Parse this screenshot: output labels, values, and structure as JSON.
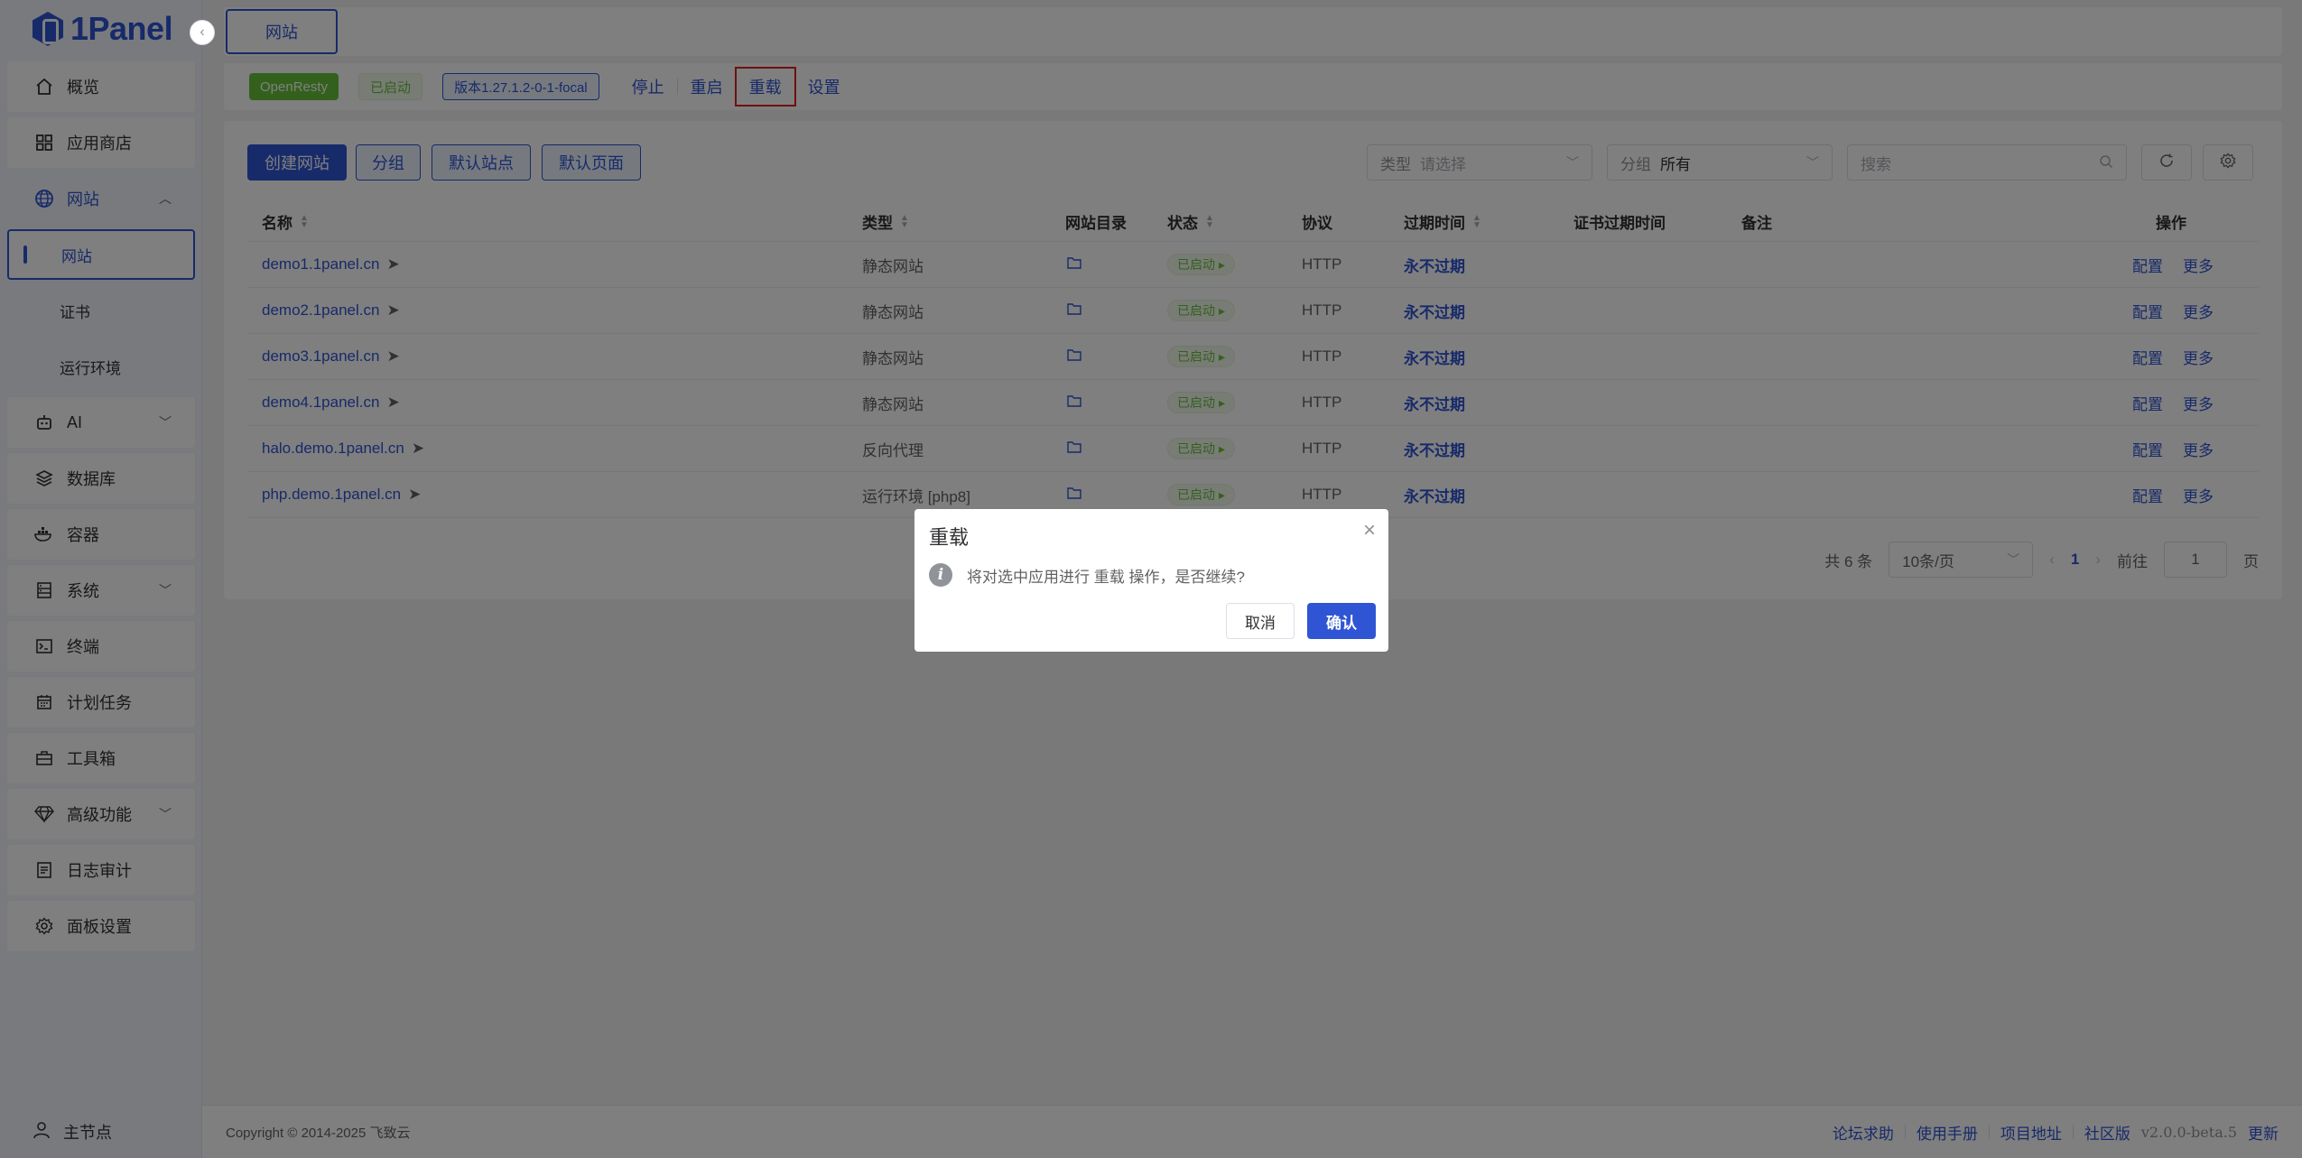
{
  "brand": {
    "name": "1Panel"
  },
  "sidebar": {
    "items": [
      {
        "label": "概览",
        "icon": "home-icon"
      },
      {
        "label": "应用商店",
        "icon": "grid-icon"
      },
      {
        "label": "网站",
        "icon": "globe-icon",
        "open": true,
        "children": [
          {
            "label": "网站",
            "active": true
          },
          {
            "label": "证书"
          },
          {
            "label": "运行环境"
          }
        ]
      },
      {
        "label": "AI",
        "icon": "robot-icon",
        "expandable": true
      },
      {
        "label": "数据库",
        "icon": "layers-icon"
      },
      {
        "label": "容器",
        "icon": "docker-icon"
      },
      {
        "label": "系统",
        "icon": "server-icon",
        "expandable": true
      },
      {
        "label": "终端",
        "icon": "terminal-icon"
      },
      {
        "label": "计划任务",
        "icon": "calendar-icon"
      },
      {
        "label": "工具箱",
        "icon": "toolbox-icon"
      },
      {
        "label": "高级功能",
        "icon": "diamond-icon",
        "expandable": true
      },
      {
        "label": "日志审计",
        "icon": "log-icon"
      },
      {
        "label": "面板设置",
        "icon": "gear-icon"
      }
    ],
    "user": "主节点"
  },
  "topbar": {
    "tab": "网站"
  },
  "appbar": {
    "app_name": "OpenResty",
    "status": "已启动",
    "version": "版本1.27.1.2-0-1-focal",
    "actions": [
      "停止",
      "重启",
      "重载",
      "设置"
    ]
  },
  "toolbar": {
    "create": "创建网站",
    "group": "分组",
    "default_site": "默认站点",
    "default_page": "默认页面",
    "type_label": "类型",
    "type_placeholder": "请选择",
    "group_label": "分组",
    "group_value": "所有",
    "search_placeholder": "搜索"
  },
  "table": {
    "headers": {
      "name": "名称",
      "type": "类型",
      "dir": "网站目录",
      "status": "状态",
      "protocol": "协议",
      "expire": "过期时间",
      "cert_expire": "证书过期时间",
      "remark": "备注",
      "ops": "操作"
    },
    "rows": [
      {
        "name": "demo1.1panel.cn",
        "type": "静态网站",
        "status": "已启动",
        "protocol": "HTTP",
        "expire": "永不过期",
        "op1": "配置",
        "op2": "更多"
      },
      {
        "name": "demo2.1panel.cn",
        "type": "静态网站",
        "status": "已启动",
        "protocol": "HTTP",
        "expire": "永不过期",
        "op1": "配置",
        "op2": "更多"
      },
      {
        "name": "demo3.1panel.cn",
        "type": "静态网站",
        "status": "已启动",
        "protocol": "HTTP",
        "expire": "永不过期",
        "op1": "配置",
        "op2": "更多"
      },
      {
        "name": "demo4.1panel.cn",
        "type": "静态网站",
        "status": "已启动",
        "protocol": "HTTP",
        "expire": "永不过期",
        "op1": "配置",
        "op2": "更多"
      },
      {
        "name": "halo.demo.1panel.cn",
        "type": "反向代理",
        "status": "已启动",
        "protocol": "HTTP",
        "expire": "永不过期",
        "op1": "配置",
        "op2": "更多"
      },
      {
        "name": "php.demo.1panel.cn",
        "type": "运行环境 [php8]",
        "status": "已启动",
        "protocol": "HTTP",
        "expire": "永不过期",
        "op1": "配置",
        "op2": "更多"
      }
    ]
  },
  "pager": {
    "total": "共 6 条",
    "page_size": "10条/页",
    "current": "1",
    "goto_label": "前往",
    "goto_value": "1",
    "page_unit": "页"
  },
  "footer": {
    "copyright": "Copyright © 2014-2025 飞致云",
    "links": [
      "论坛求助",
      "使用手册",
      "项目地址",
      "社区版"
    ],
    "version": "v2.0.0-beta.5",
    "update": "更新"
  },
  "dialog": {
    "title": "重载",
    "message": "将对选中应用进行 重载 操作，是否继续?",
    "cancel": "取消",
    "confirm": "确认"
  },
  "colors": {
    "primary": "#2f55d4",
    "success": "#67c23a",
    "highlight_outline": "#e02020"
  }
}
